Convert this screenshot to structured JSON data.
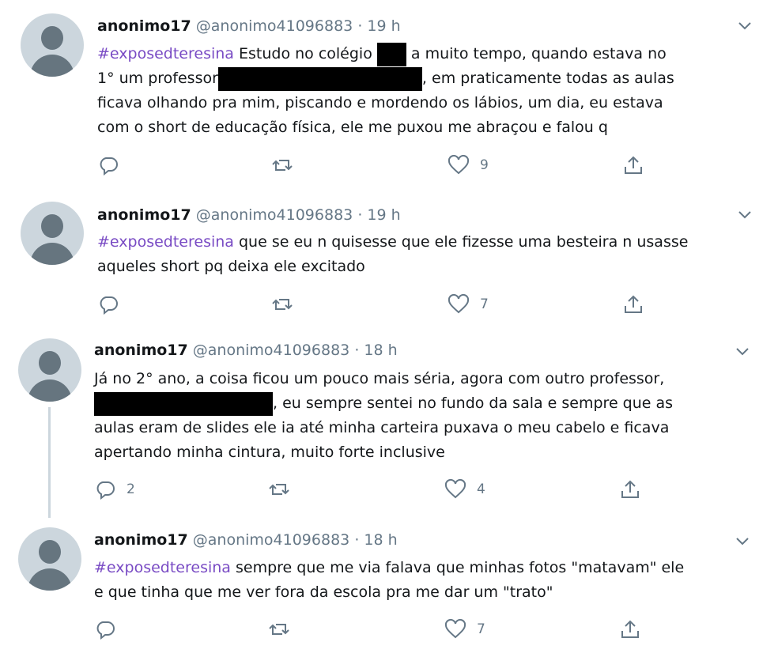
{
  "tweets": [
    {
      "name": "anonimo17",
      "handle": "@anonimo41096883",
      "separator": "·",
      "time": "19 h",
      "hashtag": "#exposedteresina",
      "line1_a": " Estudo no colégio ",
      "line1_b": " a muito tempo, quando estava no",
      "line2_a": "1° um professor",
      "line2_b": ", em praticamente todas as aulas",
      "line3": "ficava olhando pra mim, piscando e mordendo os lábios, um dia, eu estava",
      "line4": "com o short de educação física, ele me puxou me abraçou e falou q",
      "replies": "",
      "retweets": "",
      "likes": "9"
    },
    {
      "name": "anonimo17",
      "handle": "@anonimo41096883",
      "separator": "·",
      "time": "19 h",
      "hashtag": "#exposedteresina",
      "line1": " que se eu n quisesse que ele fizesse uma besteira n usasse",
      "line2": "aqueles short pq deixa ele excitado",
      "replies": "",
      "retweets": "",
      "likes": "7"
    },
    {
      "name": "anonimo17",
      "handle": "@anonimo41096883",
      "separator": "·",
      "time": "18 h",
      "line1": "Já no 2° ano, a coisa ficou um pouco mais séria, agora com outro professor,",
      "line2": ", eu sempre sentei no fundo da sala e  sempre que as",
      "line3": "aulas eram de slides ele ia até minha carteira puxava o meu cabelo e ficava",
      "line4": "apertando minha cintura, muito forte inclusive",
      "replies": "2",
      "retweets": "",
      "likes": "4"
    },
    {
      "name": "anonimo17",
      "handle": "@anonimo41096883",
      "separator": "·",
      "time": "18 h",
      "hashtag": "#exposedteresina",
      "line1": " sempre que me via falava que minhas fotos \"matavam\" ele",
      "line2": "e que tinha que me ver fora da escola pra me dar um \"trato\"",
      "replies": "",
      "retweets": "",
      "likes": "7"
    }
  ],
  "colors": {
    "hashtag": "#794bc4",
    "secondary_text": "#657786",
    "avatar_bg": "#ccd6dd",
    "avatar_fg": "#66757f"
  },
  "icons": [
    "reply-icon",
    "retweet-icon",
    "like-icon",
    "share-icon",
    "chevron-down-icon",
    "default-avatar-icon"
  ]
}
